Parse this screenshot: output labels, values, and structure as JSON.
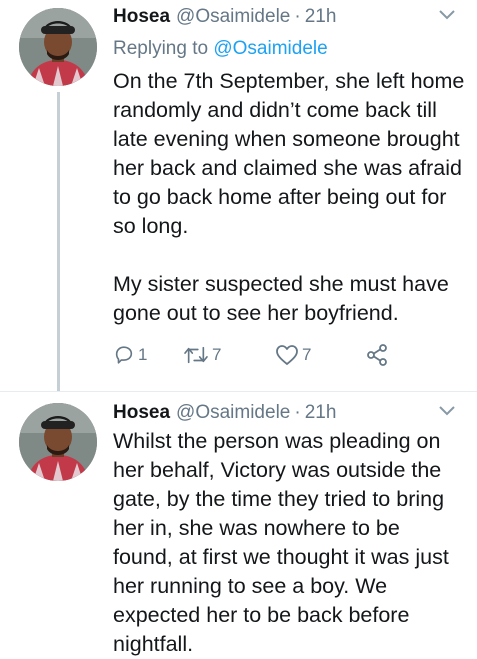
{
  "tweets": [
    {
      "name": "Hosea",
      "handle": "@Osaimidele",
      "separator": "·",
      "time": "21h",
      "replying_label": "Replying to",
      "replying_to": "@Osaimidele",
      "text": "On the 7th September, she left home randomly and didn’t come back till late evening when someone brought her back and claimed she was afraid to go back home after being out for so long.\n\nMy sister suspected she must have gone out to see her boyfriend.",
      "replies": "1",
      "retweets": "7",
      "likes": "7"
    },
    {
      "name": "Hosea",
      "handle": "@Osaimidele",
      "separator": "·",
      "time": "21h",
      "text": "Whilst the person was pleading on her behalf, Victory was outside the gate, by the time they tried to bring her in, she was nowhere to be found, at first we thought it was just her running to see a boy. We expected her to be back before nightfall."
    }
  ],
  "icons": {
    "reply": "reply-icon",
    "retweet": "retweet-icon",
    "like": "heart-icon",
    "share": "share-icon",
    "more": "chevron-down-icon"
  },
  "colors": {
    "text": "#14171a",
    "secondary": "#657786",
    "link": "#1da1f2",
    "thread_line": "#c4cfd6"
  }
}
